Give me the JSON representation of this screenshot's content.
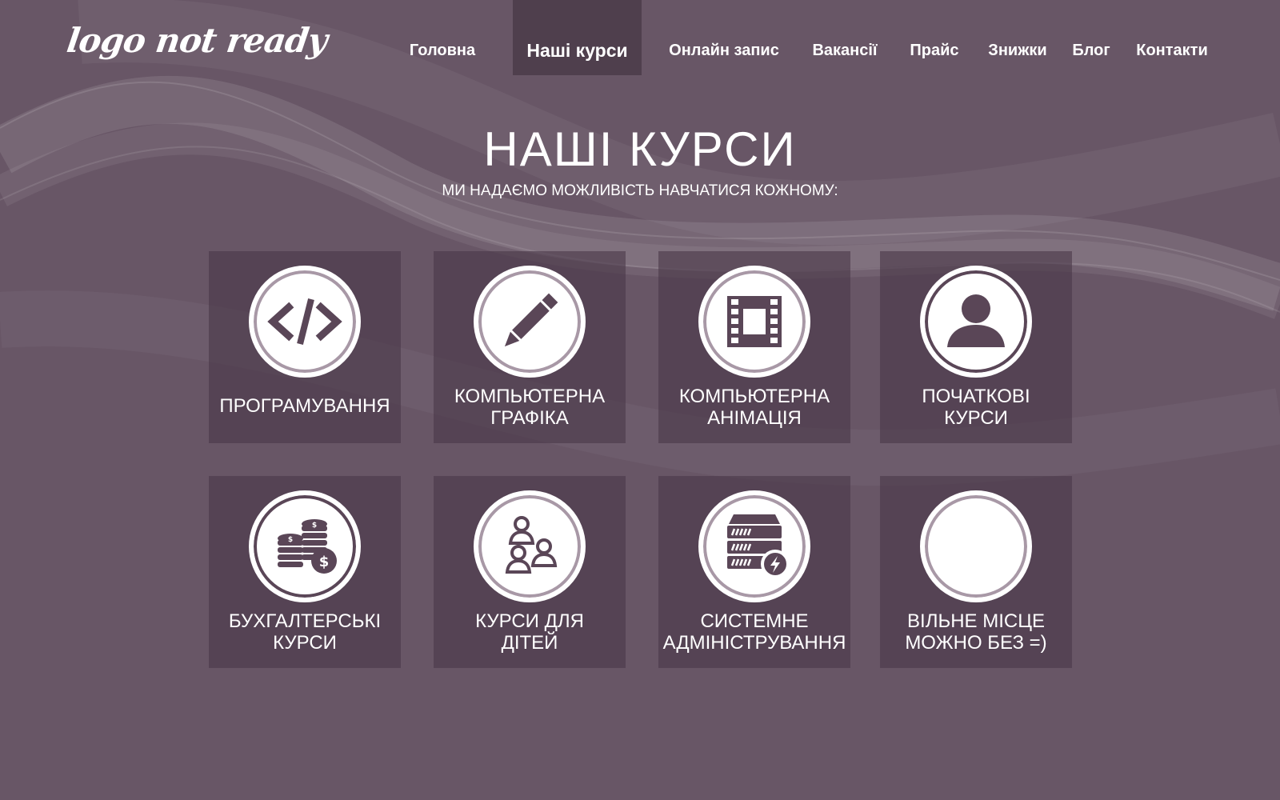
{
  "header": {
    "logo_text": "logo not ready",
    "nav": [
      {
        "label": "Головна",
        "active": false
      },
      {
        "label": "Наші курси",
        "active": true
      },
      {
        "label": "Онлайн запис",
        "active": false
      },
      {
        "label": "Вакансії",
        "active": false
      },
      {
        "label": "Прайс",
        "active": false
      },
      {
        "label": "Знижки",
        "active": false
      },
      {
        "label": "Блог",
        "active": false
      },
      {
        "label": "Контакти",
        "active": false
      }
    ]
  },
  "main": {
    "title": "НАШІ КУРСИ",
    "subtitle": "МИ НАДАЄМО МОЖЛИВІСТЬ НАВЧАТИСЯ КОЖНОМУ:",
    "courses": [
      {
        "label": "ПРОГРАМУВАННЯ",
        "icon": "code-icon"
      },
      {
        "label": "КОМПЬЮТЕРНА\nГРАФІКА",
        "icon": "pencil-icon"
      },
      {
        "label": "КОМПЬЮТЕРНА\nАНІМАЦІЯ",
        "icon": "film-icon"
      },
      {
        "label": "ПОЧАТКОВІ\nКУРСИ",
        "icon": "user-icon"
      },
      {
        "label": "БУХГАЛТЕРСЬКІ\nКУРСИ",
        "icon": "coins-icon"
      },
      {
        "label": "КУРСИ ДЛЯ\nДІТЕЙ",
        "icon": "group-icon"
      },
      {
        "label": "СИСТЕМНЕ\nАДМІНІСТРУВАННЯ",
        "icon": "server-icon"
      },
      {
        "label": "ВІЛЬНЕ МІСЦЕ\nМОЖНО БЕЗ =)",
        "icon": "empty-circle-icon"
      }
    ]
  },
  "colors": {
    "background": "#685666",
    "active_nav": "#4f3f4d",
    "tile": "#5a4858",
    "icon": "#5a4657",
    "ring": "#a898a6"
  }
}
